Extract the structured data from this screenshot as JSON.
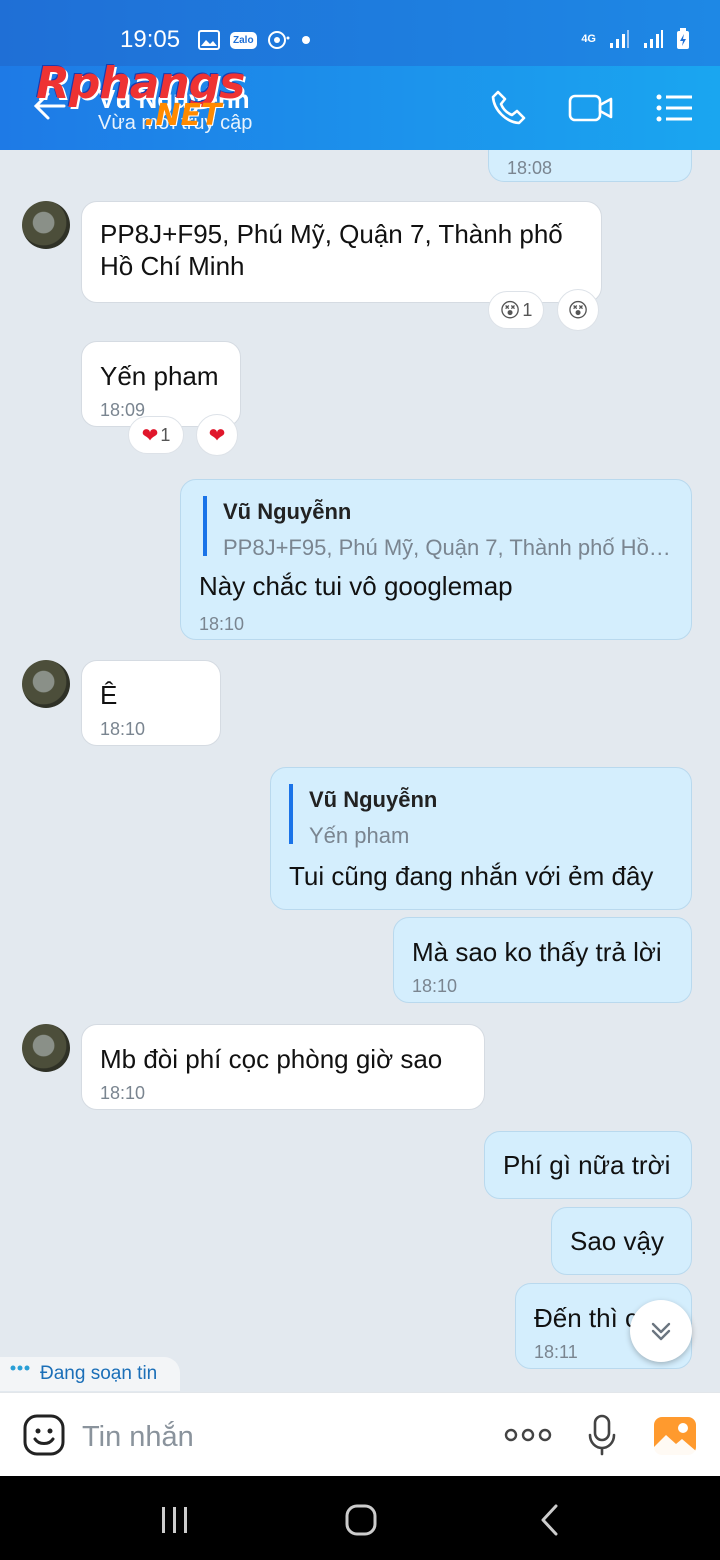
{
  "status": {
    "time": "19:05",
    "network": "4G",
    "app_badge": "Zalo"
  },
  "header": {
    "title": "Vũ Nguyễnn",
    "subtitle": "Vừa mới truy cập"
  },
  "watermark": {
    "main": "Rphangs",
    "suffix": ".NET"
  },
  "messages": [
    {
      "time": "18:08"
    },
    {
      "text": "PP8J+F95, Phú Mỹ, Quận 7, Thành phố Hồ Chí Minh",
      "reaction_count": "1"
    },
    {
      "text": "Yến pham",
      "time": "18:09",
      "reaction_count": "1"
    },
    {
      "quote_name": "Vũ Nguyễnn",
      "quote_text": "PP8J+F95, Phú Mỹ, Quận 7, Thành phố Hồ…",
      "text": "Này chắc tui vô googlemap",
      "time": "18:10"
    },
    {
      "text": "Ê",
      "time": "18:10"
    },
    {
      "quote_name": "Vũ Nguyễnn",
      "quote_text": "Yến pham",
      "text": "Tui cũng đang nhắn với ẻm đây"
    },
    {
      "text": "Mà sao ko thấy trả lời",
      "time": "18:10"
    },
    {
      "text": "Mb đòi phí cọc phòng giờ sao",
      "time": "18:10"
    },
    {
      "text": "Phí gì nữa trời"
    },
    {
      "text": "Sao vậy"
    },
    {
      "text": "Đến thì c",
      "time": "18:11"
    }
  ],
  "typing_indicator": "Đang soạn tin",
  "composer": {
    "placeholder": "Tin nhắn"
  },
  "colors": {
    "header_start": "#1e7ae6",
    "header_end": "#1aa6f0",
    "my_bubble": "#d4eefd",
    "chat_bg": "#e3e9ef"
  }
}
